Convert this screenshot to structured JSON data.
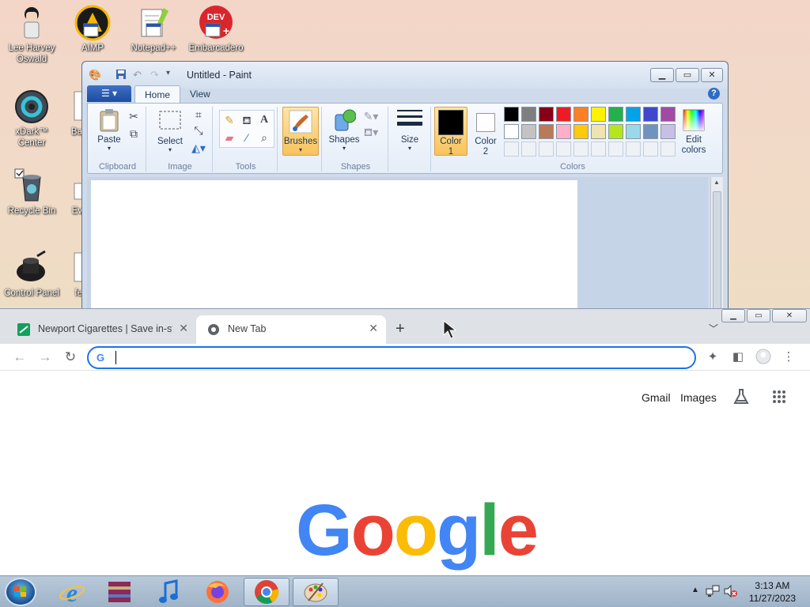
{
  "desktop": {
    "icons": [
      {
        "label": "Lee Harvey\nOswald"
      },
      {
        "label": "AIMP"
      },
      {
        "label": "Notepad++"
      },
      {
        "label": "Embarcadero"
      },
      {
        "label": "xDark™\nCenter"
      },
      {
        "label": "Ba"
      },
      {
        "label": "Recycle Bin"
      },
      {
        "label": "Ev"
      },
      {
        "label": "Control Panel"
      },
      {
        "label": "fe"
      }
    ]
  },
  "paint": {
    "title": "Untitled - Paint",
    "tabs": {
      "home": "Home",
      "view": "View"
    },
    "groups": {
      "clipboard": "Clipboard",
      "image": "Image",
      "tools": "Tools",
      "shapes": "Shapes",
      "colors": "Colors"
    },
    "buttons": {
      "paste": "Paste",
      "select": "Select",
      "brushes": "Brushes",
      "shapes": "Shapes",
      "size": "Size",
      "color1": "Color\n1",
      "color2": "Color\n2",
      "edit_colors": "Edit\ncolors"
    },
    "palette_row1": [
      "#000000",
      "#7f7f7f",
      "#880015",
      "#ed1c24",
      "#ff7f27",
      "#fff200",
      "#22b14c",
      "#00a2e8",
      "#3f48cc",
      "#a349a4"
    ],
    "palette_row2": [
      "#ffffff",
      "#c3c3c3",
      "#b97a57",
      "#ffaec9",
      "#ffc90e",
      "#efe4b0",
      "#b5e61d",
      "#99d9ea",
      "#7092be",
      "#c8bfe7"
    ]
  },
  "chrome": {
    "tabs": [
      {
        "label": "Newport Cigarettes | Save in-store"
      },
      {
        "label": "New Tab"
      }
    ],
    "omnibox": {
      "value": "",
      "placeholder": ""
    },
    "links": {
      "gmail": "Gmail",
      "images": "Images"
    },
    "logo": [
      "G",
      "o",
      "o",
      "g",
      "l",
      "e"
    ]
  },
  "taskbar": {
    "time": "3:13 AM",
    "date": "11/27/2023"
  }
}
